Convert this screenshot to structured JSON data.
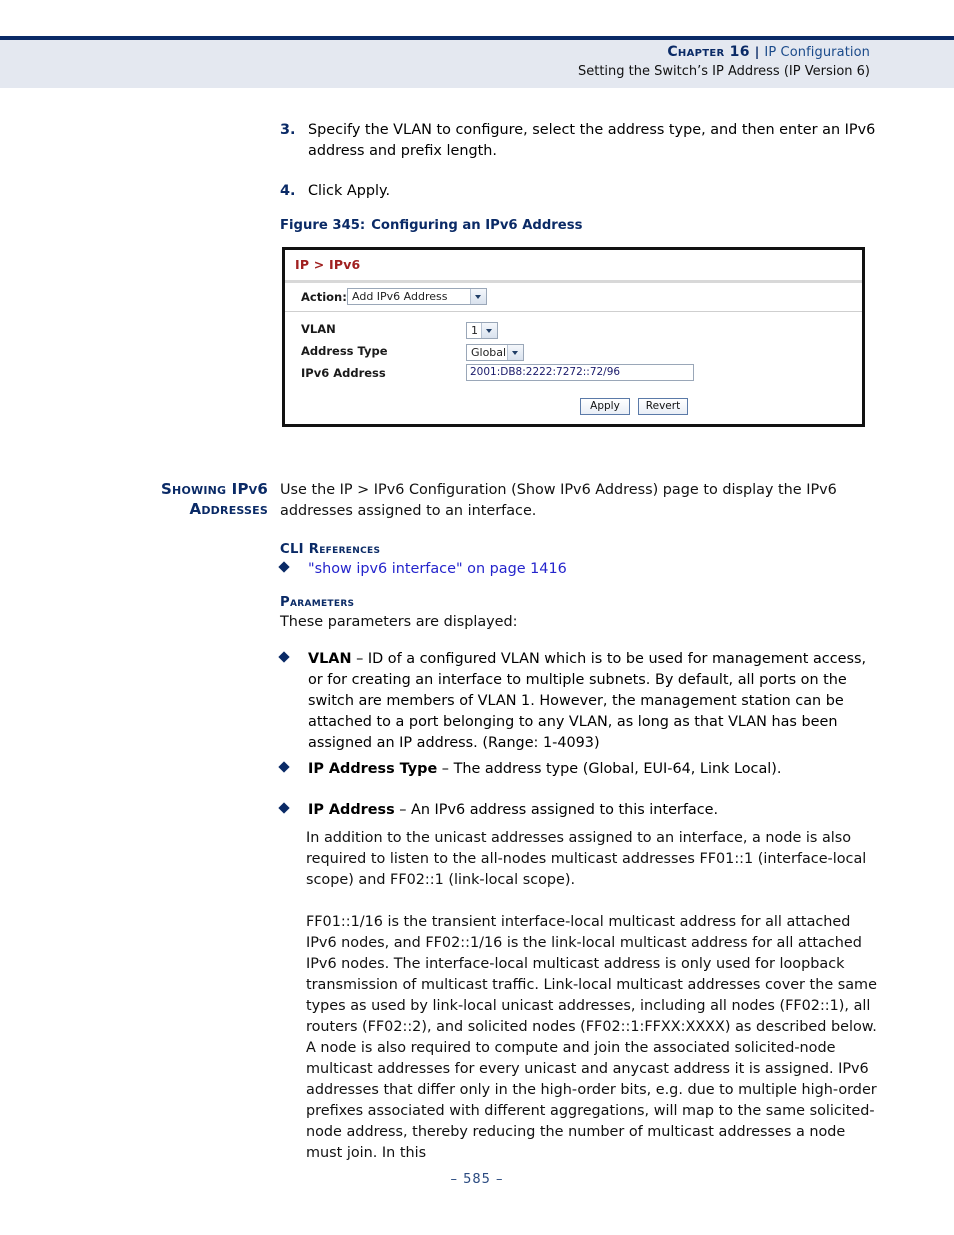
{
  "header": {
    "chapter": "Chapter 16",
    "separator": "|",
    "section": "IP Configuration",
    "subtitle": "Setting the Switch’s IP Address (IP Version 6)"
  },
  "steps": [
    {
      "num": "3.",
      "text": "Specify the VLAN to configure, select the address type, and then enter an IPv6 address and prefix length."
    },
    {
      "num": "4.",
      "text": "Click Apply."
    }
  ],
  "figure": {
    "caption_number": "Figure 345:",
    "caption_title": "Configuring an IPv6 Address",
    "panel_title": "IP > IPv6",
    "action_label": "Action:",
    "action_value": "Add IPv6 Address",
    "fields": {
      "vlan_label": "VLAN",
      "vlan_value": "1",
      "type_label": "Address Type",
      "type_value": "Global",
      "address_label": "IPv6 Address",
      "address_value": "2001:DB8:2222:7272::72/96"
    },
    "buttons": {
      "apply": "Apply",
      "revert": "Revert"
    }
  },
  "section": {
    "side_heading_line1": "Showing IPv6",
    "side_heading_line2": "Addresses",
    "intro": "Use the IP > IPv6 Configuration (Show IPv6 Address) page to display the IPv6 addresses assigned to an interface.",
    "cli_heading": "CLI References",
    "cli_links": [
      "\"show ipv6 interface\" on page 1416"
    ],
    "parameters_heading": "Parameters",
    "parameters_intro": "These parameters are displayed:",
    "bullets": [
      {
        "term": "VLAN",
        "dash": " – ",
        "text": "ID of a configured VLAN which is to be used for management access, or for creating an interface to multiple subnets. By default, all ports on the switch are members of VLAN 1. However, the management station can be attached to a port belonging to any VLAN, as long as that VLAN has been assigned an IP address. (Range: 1-4093)"
      },
      {
        "term": "IP Address Type",
        "dash": " – ",
        "text": "The address type (Global, EUI-64, Link Local)."
      },
      {
        "term": "IP Address",
        "dash": " – ",
        "text": "An IPv6 address assigned to this interface."
      }
    ],
    "body_paragraphs": [
      "In addition to the unicast addresses assigned to an interface, a node is also required to listen to the all-nodes multicast addresses FF01::1 (interface-local scope) and FF02::1 (link-local scope).",
      "FF01::1/16 is the transient interface-local multicast address for all attached IPv6 nodes, and FF02::1/16 is the link-local multicast address for all attached IPv6 nodes. The interface-local multicast address is only used for loopback transmission of multicast traffic. Link-local multicast addresses cover the same types as used by link-local unicast addresses, including all nodes (FF02::1), all routers (FF02::2), and solicited nodes (FF02::1:FFXX:XXXX) as described below.",
      "A node is also required to compute and join the associated solicited-node multicast addresses for every unicast and anycast address it is assigned. IPv6 addresses that differ only in the high-order bits, e.g. due to multiple high-order prefixes associated with different aggregations, will map to the same solicited-node address, thereby reducing the number of multicast addresses a node must join. In this"
    ]
  },
  "footer": {
    "page": "–  585  –"
  },
  "colors": {
    "accent_navy": "#0a2a66",
    "link_blue": "#2424cc",
    "panel_title_red": "#a02020",
    "header_band": "#e4e8f0"
  }
}
